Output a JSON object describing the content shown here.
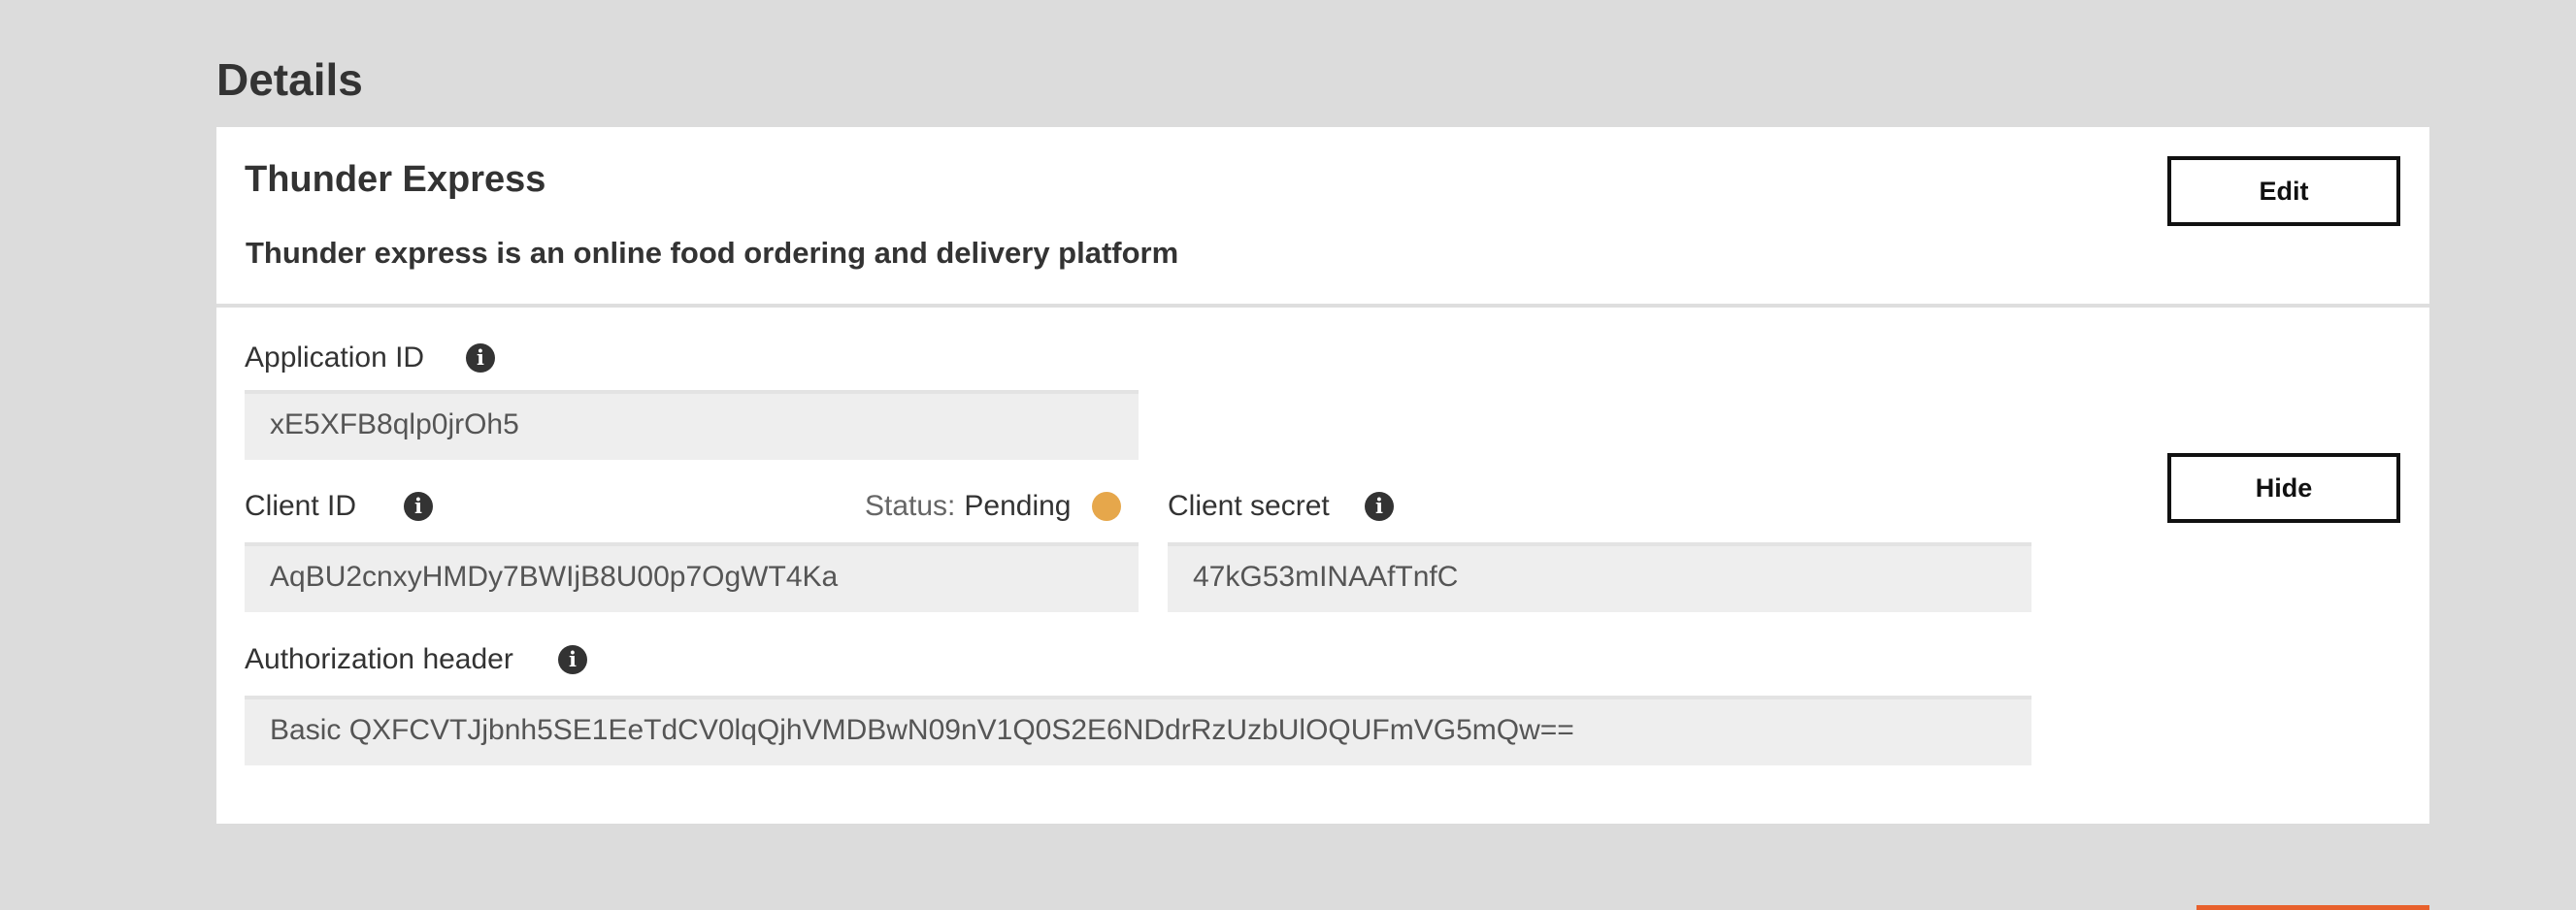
{
  "section": {
    "title": "Details"
  },
  "app": {
    "name": "Thunder Express",
    "description": "Thunder express is an online food ordering and delivery platform",
    "edit_label": "Edit",
    "hide_label": "Hide"
  },
  "fields": {
    "application_id": {
      "label": "Application ID",
      "value": "xE5XFB8qlp0jrOh5",
      "icon": "info-icon"
    },
    "client_id": {
      "label": "Client ID",
      "value": "AqBU2cnxyHMDy7BWIjB8U00p7OgWT4Ka",
      "icon": "info-icon"
    },
    "status": {
      "label": "Status:",
      "value": "Pending",
      "color": "#e6a74b"
    },
    "client_secret": {
      "label": "Client secret",
      "value": "47kG53mINAAfTnfC",
      "icon": "info-icon"
    },
    "authorization_header": {
      "label": "Authorization header",
      "value": "Basic QXFCVTJjbnh5SE1EeTdCV0lqQjhVMDBwN09nV1Q0S2E6NDdrRzUzbUlOQUFmVG5mQw==",
      "icon": "info-icon"
    }
  },
  "icons": {
    "info_glyph": "i"
  },
  "colors": {
    "page_background": "#dcdcdc",
    "card_background": "#ffffff",
    "field_background": "#eeeeee",
    "status_pending": "#e6a74b",
    "accent": "#e8602c"
  }
}
